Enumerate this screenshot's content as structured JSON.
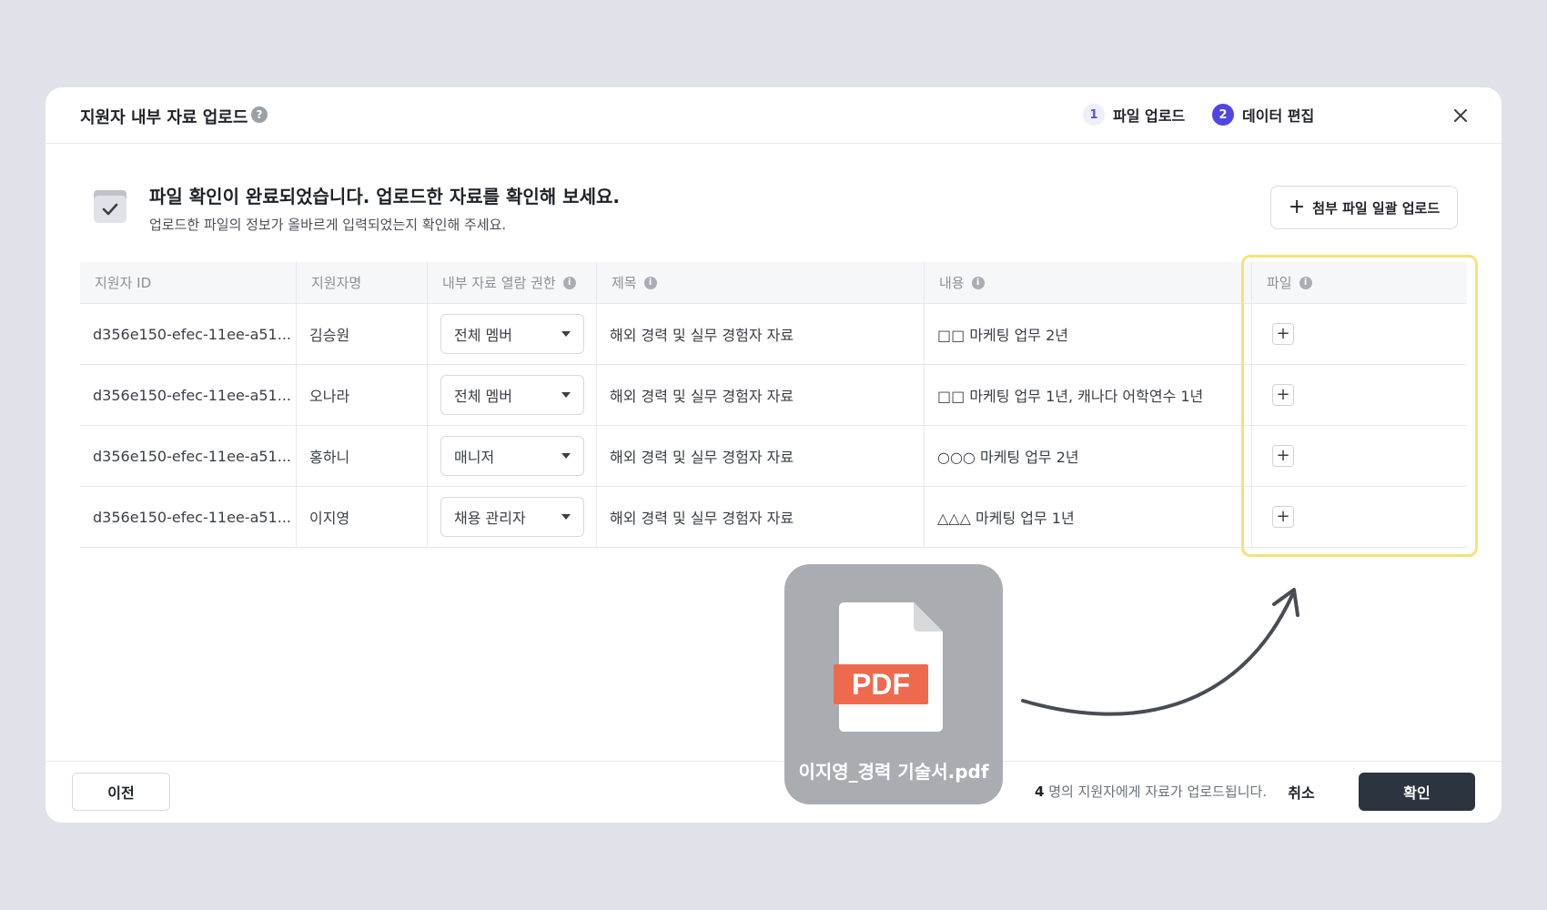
{
  "modal": {
    "title": "지원자 내부 자료 업로드",
    "steps": [
      {
        "num": "1",
        "label": "파일 업로드"
      },
      {
        "num": "2",
        "label": "데이터 편집"
      }
    ]
  },
  "banner": {
    "title": "파일 확인이 완료되었습니다. 업로드한 자료를 확인해 보세요.",
    "subtitle": "업로드한 파일의 정보가 올바르게 입력되었는지 확인해 주세요.",
    "bulk_upload_label": "첨부 파일 일괄 업로드"
  },
  "table": {
    "headers": [
      "지원자 ID",
      "지원자명",
      "내부 자료 열람 권한",
      "제목",
      "내용",
      "파일"
    ],
    "rows": [
      {
        "id": "d356e150-efec-11ee-a51...",
        "name": "김승원",
        "permission": "전체 멤버",
        "title": "해외 경력 및 실무 경험자 자료",
        "content": "□□ 마케팅 업무 2년"
      },
      {
        "id": "d356e150-efec-11ee-a51...",
        "name": "오나라",
        "permission": "전체 멤버",
        "title": "해외 경력 및 실무 경험자 자료",
        "content": "□□ 마케팅 업무 1년, 캐나다 어학연수 1년"
      },
      {
        "id": "d356e150-efec-11ee-a51...",
        "name": "홍하니",
        "permission": "매니저",
        "title": "해외 경력 및 실무 경험자 자료",
        "content": "○○○ 마케팅 업무 2년"
      },
      {
        "id": "d356e150-efec-11ee-a51...",
        "name": "이지영",
        "permission": "채용 관리자",
        "title": "해외 경력 및 실무 경험자 자료",
        "content": "△△△ 마케팅 업무 1년"
      }
    ]
  },
  "drag": {
    "badge": "PDF",
    "filename": "이지영_경력 기술서.pdf"
  },
  "footer": {
    "prev_label": "이전",
    "count": "4",
    "note_suffix": " 명의 지원자에게 자료가 업로드됩니다.",
    "cancel_label": "취소",
    "confirm_label": "확인"
  },
  "colors": {
    "accent": "#4f46e5",
    "highlight": "#f5e27c",
    "pdf_badge": "#ee6a4f",
    "primary_button": "#2c3440"
  }
}
